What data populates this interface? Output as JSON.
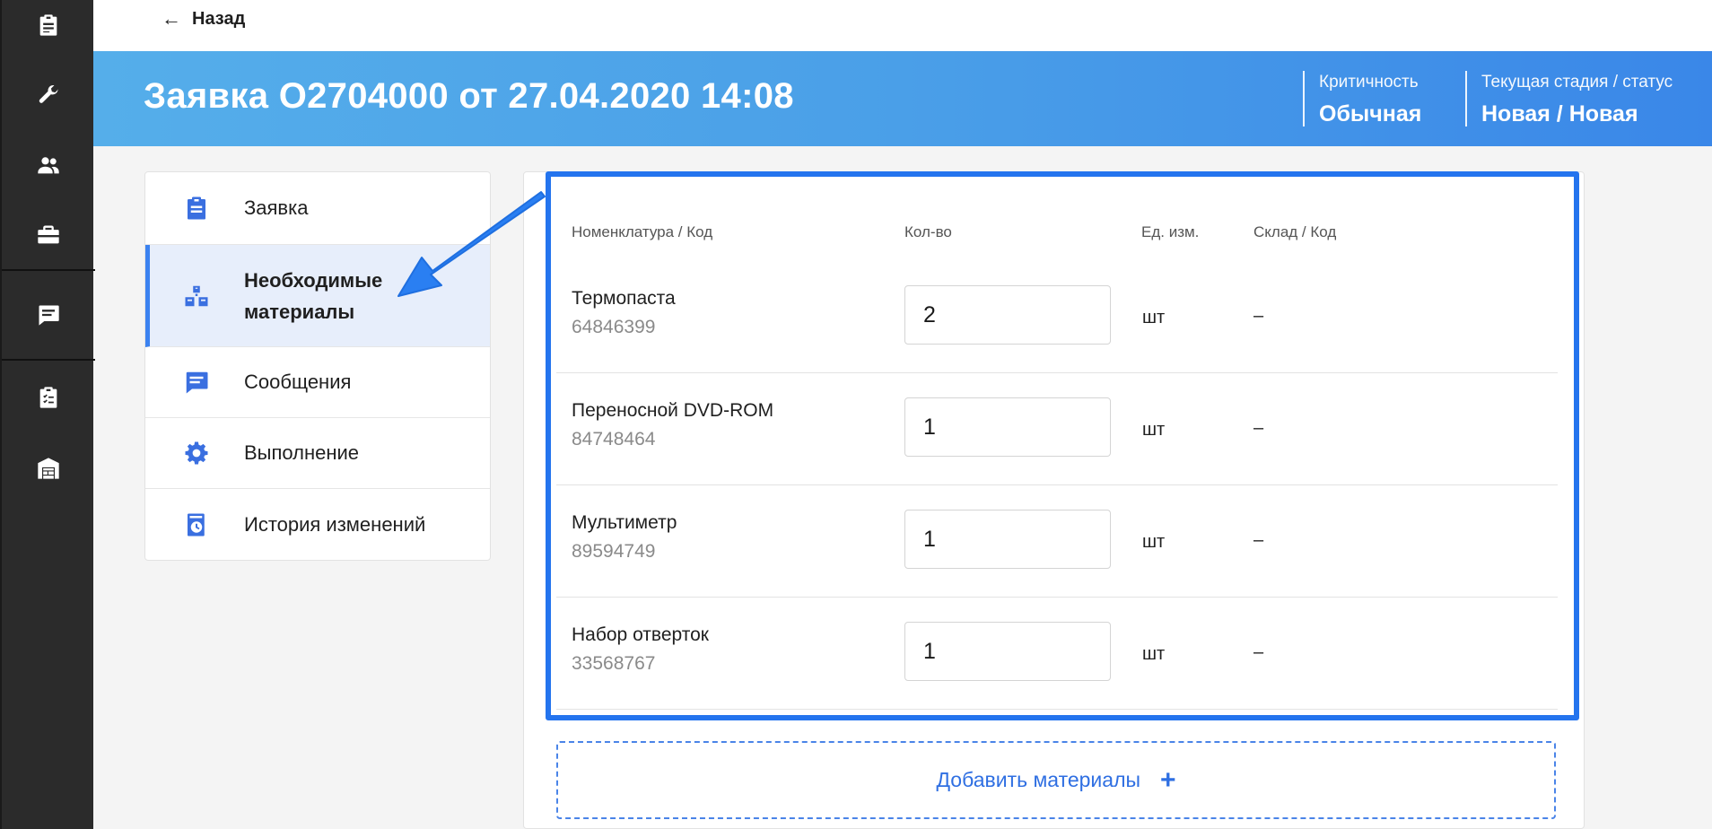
{
  "nav": {
    "back_label": "Назад",
    "rail_icons": [
      "clipboard-icon",
      "wrench-icon",
      "users-icon",
      "briefcase-icon",
      "chat-icon",
      "checklist-icon",
      "warehouse-icon"
    ]
  },
  "header": {
    "title": "Заявка O2704000 от 27.04.2020 14:08",
    "criticality_label": "Критичность",
    "criticality_value": "Обычная",
    "stage_label": "Текущая стадия / статус",
    "stage_value": "Новая / Новая"
  },
  "menu": {
    "items": [
      {
        "label": "Заявка",
        "icon": "clipboard-icon"
      },
      {
        "label": "Необходимые",
        "label2": "материалы",
        "icon": "boxes-icon",
        "active": true
      },
      {
        "label": "Сообщения",
        "icon": "message-icon"
      },
      {
        "label": "Выполнение",
        "icon": "gear-icon"
      },
      {
        "label": "История изменений",
        "icon": "history-icon"
      }
    ]
  },
  "materials": {
    "columns": [
      "Номенклатура / Код",
      "Кол-во",
      "Ед. изм.",
      "Склад / Код"
    ],
    "rows": [
      {
        "name": "Термопаста",
        "code": "64846399",
        "qty": "2",
        "unit": "шт",
        "warehouse": "–"
      },
      {
        "name": "Переносной DVD-ROM",
        "code": "84748464",
        "qty": "1",
        "unit": "шт",
        "warehouse": "–"
      },
      {
        "name": "Мультиметр",
        "code": "89594749",
        "qty": "1",
        "unit": "шт",
        "warehouse": "–"
      },
      {
        "name": "Набор отверток",
        "code": "33568767",
        "qty": "1",
        "unit": "шт",
        "warehouse": "–"
      }
    ],
    "add_label": "Добавить материалы",
    "add_icon": "+"
  },
  "colors": {
    "accent": "#2474ee",
    "header_gradient_start": "#55aeea",
    "header_gradient_end": "#3a87e8",
    "rail_bg": "#2b2b2b",
    "active_menu_bg": "#e7eefb"
  }
}
